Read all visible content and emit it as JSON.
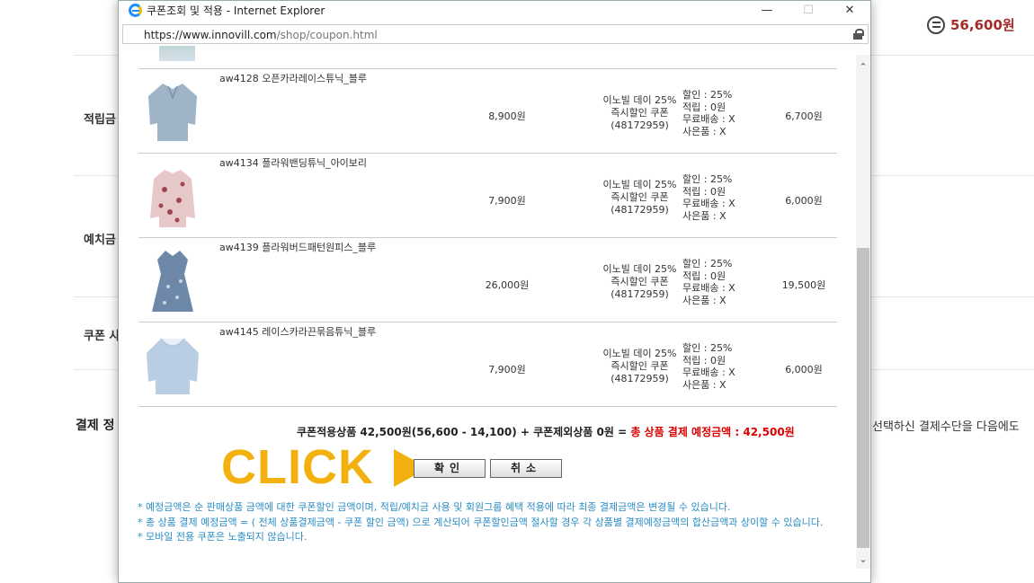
{
  "background": {
    "total_amount": "56,600원",
    "sections": [
      "적립금",
      "예치금",
      "쿠폰 사",
      "결제 정"
    ],
    "right_text": "선택하신 결제수단을 다음에도"
  },
  "popup": {
    "window_title": "쿠폰조회 및 적용 - Internet Explorer",
    "url_host": "https://www.innovill.com",
    "url_path": "/shop/coupon.html",
    "items": [
      {
        "name": "aw4128 오픈카라레이스튜닉_블루",
        "price": "8,900원",
        "coupon_name": "이노빌 데이 25%",
        "coupon_type": "즉시할인 쿠폰",
        "coupon_id": "(48172959)",
        "discount": "할인 : 25%",
        "points": "적립 : 0원",
        "free_shipping": "무료배송 : X",
        "gift": "사은품 : X",
        "final_price": "6,700원",
        "thumb_color": "#9fb4c6"
      },
      {
        "name": "aw4134 플라워밴딩튜닉_아이보리",
        "price": "7,900원",
        "coupon_name": "이노빌 데이 25%",
        "coupon_type": "즉시할인 쿠폰",
        "coupon_id": "(48172959)",
        "discount": "할인 : 25%",
        "points": "적립 : 0원",
        "free_shipping": "무료배송 : X",
        "gift": "사은품 : X",
        "final_price": "6,000원",
        "thumb_color": "#c98f95"
      },
      {
        "name": "aw4139 플라워버드패턴원피스_블루",
        "price": "26,000원",
        "coupon_name": "이노빌 데이 25%",
        "coupon_type": "즉시할인 쿠폰",
        "coupon_id": "(48172959)",
        "discount": "할인 : 25%",
        "points": "적립 : 0원",
        "free_shipping": "무료배송 : X",
        "gift": "사은품 : X",
        "final_price": "19,500원",
        "thumb_color": "#6d88a8"
      },
      {
        "name": "aw4145 레이스카라끈묶음튜닉_블루",
        "price": "7,900원",
        "coupon_name": "이노빌 데이 25%",
        "coupon_type": "즉시할인 쿠폰",
        "coupon_id": "(48172959)",
        "discount": "할인 : 25%",
        "points": "적립 : 0원",
        "free_shipping": "무료배송 : X",
        "gift": "사은품 : X",
        "final_price": "6,000원",
        "thumb_color": "#b9cde3"
      }
    ],
    "summary_prefix": "쿠폰적용상품 42,500원(56,600 - 14,100) + 쿠폰제외상품 0원 = ",
    "summary_total": "총 상품 결제 예정금액 : 42,500원",
    "click_label": "CLICK",
    "ok_button": "확인",
    "cancel_button": "취소",
    "notes": [
      "* 예정금액은 순 판매상품 금액에 대한 쿠폰할인 금액이며, 적립/예치금 사용 및 회원그룹 혜택 적용에 따라 최종 결제금액은 변경될 수 있습니다.",
      "* 총 상품 결제 예정금액 = ( 전체 상품결제금액 - 쿠폰 할인 금액) 으로 계산되어 쿠폰할인금액 절사할 경우 각 상품별 결제예정금액의 합산금액과 상이할 수 있습니다.",
      "* 모바일 전용 쿠폰은 노출되지 않습니다."
    ]
  }
}
